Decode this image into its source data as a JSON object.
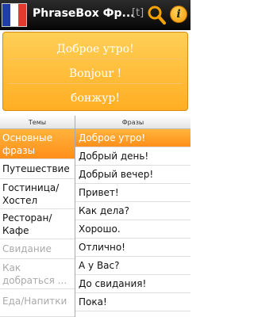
{
  "app": {
    "title": "PhraseBox Фр...",
    "transliteration_toggle": "[t]"
  },
  "flag": {
    "colors": [
      "#1f3ea8",
      "#ffffff",
      "#e23a2e"
    ]
  },
  "translation": {
    "russian": "Доброе утро!",
    "french": "Bonjour !",
    "transliteration": "бонжур!"
  },
  "headers": {
    "topics": "Темы",
    "phrases": "Фразы"
  },
  "topics": [
    {
      "label": "Основные фразы",
      "selected": true
    },
    {
      "label": "Путешествие"
    },
    {
      "label": "Гостиница/ Хостел"
    },
    {
      "label": "Ресторан/ Кафе"
    },
    {
      "label": "Свидание",
      "disabled": true
    },
    {
      "label": "Как добраться ...",
      "disabled": true
    },
    {
      "label": "Еда/Напитки",
      "disabled": true
    }
  ],
  "phrases": [
    "Доброе утро!",
    "Добрый день!",
    "Добрый вечер!",
    "Привет!",
    "Как дела?",
    "Хорошо.",
    "Отлично!",
    "А у Вас?",
    "До свидания!",
    "Пока!"
  ],
  "accent_colors": {
    "orange_light": "#ffcf56",
    "orange_dark": "#ff8f1a"
  }
}
